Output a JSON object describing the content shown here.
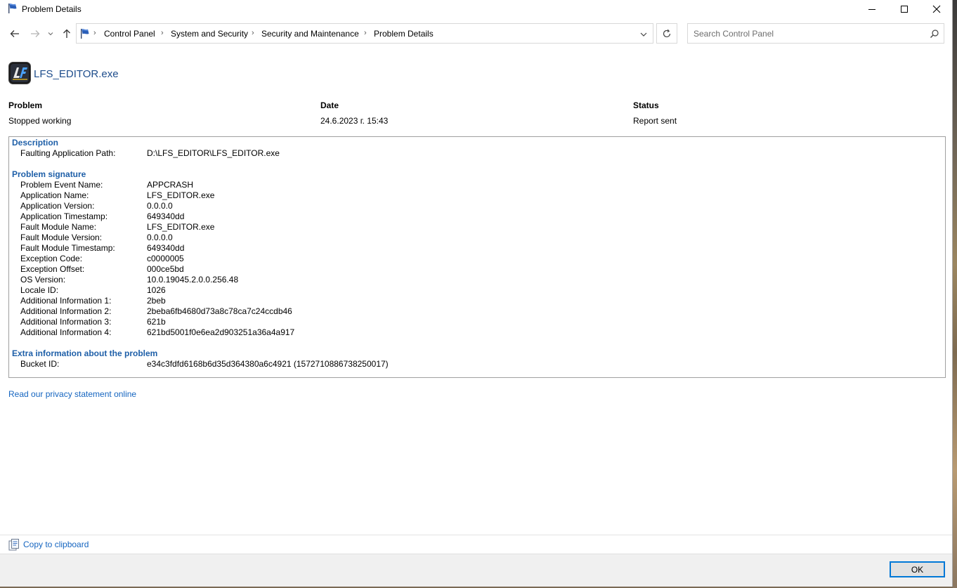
{
  "window": {
    "title": "Problem Details"
  },
  "nav": {
    "breadcrumbs": [
      "Control Panel",
      "System and Security",
      "Security and Maintenance",
      "Problem Details"
    ],
    "search_placeholder": "Search Control Panel"
  },
  "app": {
    "name": "LFS_EDITOR.exe"
  },
  "summary": {
    "problem_label": "Problem",
    "problem_value": "Stopped working",
    "date_label": "Date",
    "date_value": "24.6.2023 г. 15:43",
    "status_label": "Status",
    "status_value": "Report sent"
  },
  "description": {
    "title": "Description",
    "rows": [
      {
        "key": "Faulting Application Path:",
        "value": "D:\\LFS_EDITOR\\LFS_EDITOR.exe"
      }
    ]
  },
  "signature": {
    "title": "Problem signature",
    "rows": [
      {
        "key": "Problem Event Name:",
        "value": "APPCRASH"
      },
      {
        "key": "Application Name:",
        "value": "LFS_EDITOR.exe"
      },
      {
        "key": "Application Version:",
        "value": "0.0.0.0"
      },
      {
        "key": "Application Timestamp:",
        "value": "649340dd"
      },
      {
        "key": "Fault Module Name:",
        "value": "LFS_EDITOR.exe"
      },
      {
        "key": "Fault Module Version:",
        "value": "0.0.0.0"
      },
      {
        "key": "Fault Module Timestamp:",
        "value": "649340dd"
      },
      {
        "key": "Exception Code:",
        "value": "c0000005"
      },
      {
        "key": "Exception Offset:",
        "value": "000ce5bd"
      },
      {
        "key": "OS Version:",
        "value": "10.0.19045.2.0.0.256.48"
      },
      {
        "key": "Locale ID:",
        "value": "1026"
      },
      {
        "key": "Additional Information 1:",
        "value": "2beb"
      },
      {
        "key": "Additional Information 2:",
        "value": "2beba6fb4680d73a8c78ca7c24ccdb46"
      },
      {
        "key": "Additional Information 3:",
        "value": "621b"
      },
      {
        "key": "Additional Information 4:",
        "value": "621bd5001f0e6ea2d903251a36a4a917"
      }
    ]
  },
  "extra": {
    "title": "Extra information about the problem",
    "rows": [
      {
        "key": "Bucket ID:",
        "value": "e34c3fdfd6168b6d35d364380a6c4921 (1572710886738250017)"
      }
    ]
  },
  "links": {
    "privacy": "Read our privacy statement online",
    "copy": "Copy to clipboard"
  },
  "buttons": {
    "ok": "OK"
  },
  "colors": {
    "link": "#1565c0",
    "section_title": "#1e5fa8",
    "ok_border": "#0078d7"
  }
}
